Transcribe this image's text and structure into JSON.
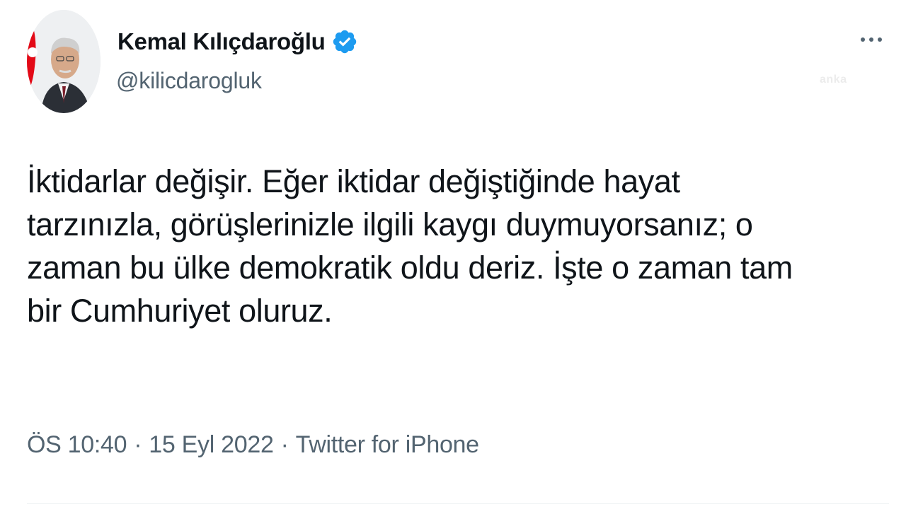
{
  "author": {
    "display_name": "Kemal Kılıçdaroğlu",
    "handle": "@kilicdarogluk",
    "verified_icon": "verified-badge-icon",
    "verified_color": "#1d9bf0"
  },
  "more_icon": "more-horizontal-icon",
  "watermark": "anka",
  "tweet": {
    "text": "İktidarlar değişir. Eğer iktidar değiştiğinde hayat\ntarzınızla, görüşlerinizle ilgili kaygı duymuyorsanız; o\nzaman bu ülke demokratik oldu deriz. İşte o zaman tam\nbir Cumhuriyet oluruz."
  },
  "meta": {
    "time": "ÖS 10:40",
    "separator": "·",
    "date": "15 Eyl 2022",
    "source": "Twitter for iPhone"
  },
  "colors": {
    "text_primary": "#0f1419",
    "text_secondary": "#536471",
    "accent": "#1d9bf0",
    "flag_red": "#e30a17"
  }
}
